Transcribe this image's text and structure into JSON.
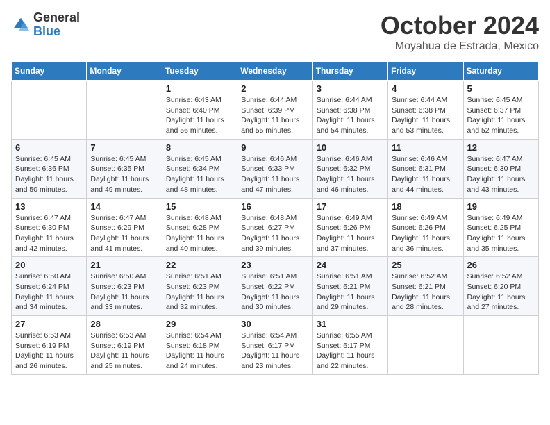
{
  "header": {
    "logo_general": "General",
    "logo_blue": "Blue",
    "month_title": "October 2024",
    "location": "Moyahua de Estrada, Mexico"
  },
  "weekdays": [
    "Sunday",
    "Monday",
    "Tuesday",
    "Wednesday",
    "Thursday",
    "Friday",
    "Saturday"
  ],
  "weeks": [
    [
      {
        "day": "",
        "info": ""
      },
      {
        "day": "",
        "info": ""
      },
      {
        "day": "1",
        "info": "Sunrise: 6:43 AM\nSunset: 6:40 PM\nDaylight: 11 hours and 56 minutes."
      },
      {
        "day": "2",
        "info": "Sunrise: 6:44 AM\nSunset: 6:39 PM\nDaylight: 11 hours and 55 minutes."
      },
      {
        "day": "3",
        "info": "Sunrise: 6:44 AM\nSunset: 6:38 PM\nDaylight: 11 hours and 54 minutes."
      },
      {
        "day": "4",
        "info": "Sunrise: 6:44 AM\nSunset: 6:38 PM\nDaylight: 11 hours and 53 minutes."
      },
      {
        "day": "5",
        "info": "Sunrise: 6:45 AM\nSunset: 6:37 PM\nDaylight: 11 hours and 52 minutes."
      }
    ],
    [
      {
        "day": "6",
        "info": "Sunrise: 6:45 AM\nSunset: 6:36 PM\nDaylight: 11 hours and 50 minutes."
      },
      {
        "day": "7",
        "info": "Sunrise: 6:45 AM\nSunset: 6:35 PM\nDaylight: 11 hours and 49 minutes."
      },
      {
        "day": "8",
        "info": "Sunrise: 6:45 AM\nSunset: 6:34 PM\nDaylight: 11 hours and 48 minutes."
      },
      {
        "day": "9",
        "info": "Sunrise: 6:46 AM\nSunset: 6:33 PM\nDaylight: 11 hours and 47 minutes."
      },
      {
        "day": "10",
        "info": "Sunrise: 6:46 AM\nSunset: 6:32 PM\nDaylight: 11 hours and 46 minutes."
      },
      {
        "day": "11",
        "info": "Sunrise: 6:46 AM\nSunset: 6:31 PM\nDaylight: 11 hours and 44 minutes."
      },
      {
        "day": "12",
        "info": "Sunrise: 6:47 AM\nSunset: 6:30 PM\nDaylight: 11 hours and 43 minutes."
      }
    ],
    [
      {
        "day": "13",
        "info": "Sunrise: 6:47 AM\nSunset: 6:30 PM\nDaylight: 11 hours and 42 minutes."
      },
      {
        "day": "14",
        "info": "Sunrise: 6:47 AM\nSunset: 6:29 PM\nDaylight: 11 hours and 41 minutes."
      },
      {
        "day": "15",
        "info": "Sunrise: 6:48 AM\nSunset: 6:28 PM\nDaylight: 11 hours and 40 minutes."
      },
      {
        "day": "16",
        "info": "Sunrise: 6:48 AM\nSunset: 6:27 PM\nDaylight: 11 hours and 39 minutes."
      },
      {
        "day": "17",
        "info": "Sunrise: 6:49 AM\nSunset: 6:26 PM\nDaylight: 11 hours and 37 minutes."
      },
      {
        "day": "18",
        "info": "Sunrise: 6:49 AM\nSunset: 6:26 PM\nDaylight: 11 hours and 36 minutes."
      },
      {
        "day": "19",
        "info": "Sunrise: 6:49 AM\nSunset: 6:25 PM\nDaylight: 11 hours and 35 minutes."
      }
    ],
    [
      {
        "day": "20",
        "info": "Sunrise: 6:50 AM\nSunset: 6:24 PM\nDaylight: 11 hours and 34 minutes."
      },
      {
        "day": "21",
        "info": "Sunrise: 6:50 AM\nSunset: 6:23 PM\nDaylight: 11 hours and 33 minutes."
      },
      {
        "day": "22",
        "info": "Sunrise: 6:51 AM\nSunset: 6:23 PM\nDaylight: 11 hours and 32 minutes."
      },
      {
        "day": "23",
        "info": "Sunrise: 6:51 AM\nSunset: 6:22 PM\nDaylight: 11 hours and 30 minutes."
      },
      {
        "day": "24",
        "info": "Sunrise: 6:51 AM\nSunset: 6:21 PM\nDaylight: 11 hours and 29 minutes."
      },
      {
        "day": "25",
        "info": "Sunrise: 6:52 AM\nSunset: 6:21 PM\nDaylight: 11 hours and 28 minutes."
      },
      {
        "day": "26",
        "info": "Sunrise: 6:52 AM\nSunset: 6:20 PM\nDaylight: 11 hours and 27 minutes."
      }
    ],
    [
      {
        "day": "27",
        "info": "Sunrise: 6:53 AM\nSunset: 6:19 PM\nDaylight: 11 hours and 26 minutes."
      },
      {
        "day": "28",
        "info": "Sunrise: 6:53 AM\nSunset: 6:19 PM\nDaylight: 11 hours and 25 minutes."
      },
      {
        "day": "29",
        "info": "Sunrise: 6:54 AM\nSunset: 6:18 PM\nDaylight: 11 hours and 24 minutes."
      },
      {
        "day": "30",
        "info": "Sunrise: 6:54 AM\nSunset: 6:17 PM\nDaylight: 11 hours and 23 minutes."
      },
      {
        "day": "31",
        "info": "Sunrise: 6:55 AM\nSunset: 6:17 PM\nDaylight: 11 hours and 22 minutes."
      },
      {
        "day": "",
        "info": ""
      },
      {
        "day": "",
        "info": ""
      }
    ]
  ]
}
